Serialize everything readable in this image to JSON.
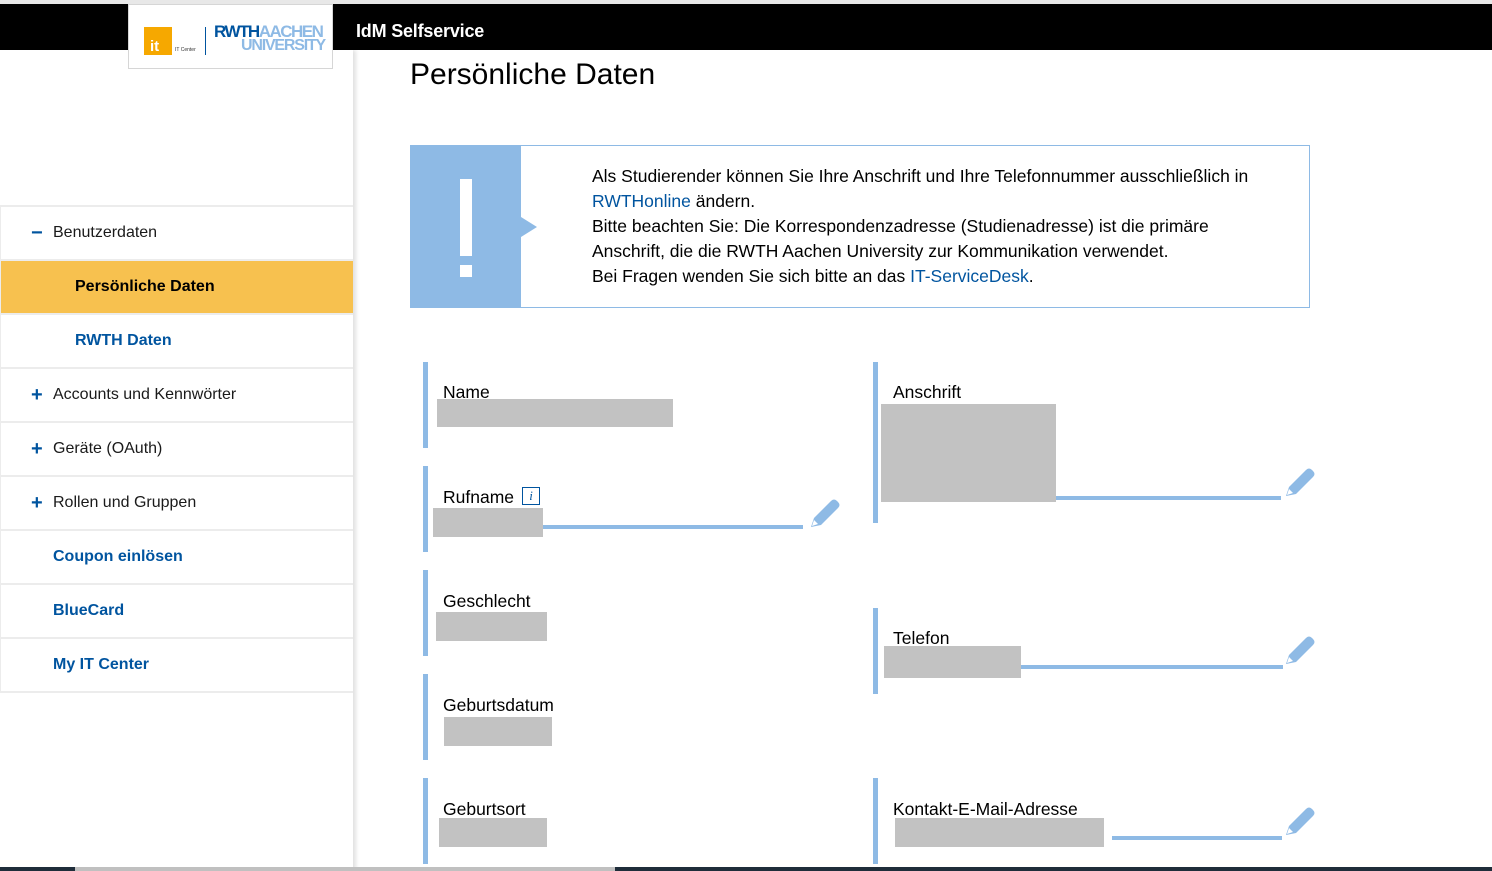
{
  "header": {
    "app_title": "IdM Selfservice",
    "logo": {
      "it_mark": "it",
      "it_center": "IT Center",
      "rwth": "RWTH",
      "aachen": "AACHEN",
      "university": "UNIVERSITY"
    }
  },
  "sidebar": {
    "items": [
      {
        "label": "Benutzerdaten",
        "symbol": "−",
        "state": "expanded"
      },
      {
        "label": "Persönliche Daten",
        "state": "active"
      },
      {
        "label": "RWTH Daten"
      },
      {
        "label": "Accounts und Kennwörter",
        "symbol": "+"
      },
      {
        "label": "Geräte (OAuth)",
        "symbol": "+"
      },
      {
        "label": "Rollen und Gruppen",
        "symbol": "+"
      },
      {
        "label": "Coupon einlösen"
      },
      {
        "label": "BlueCard"
      },
      {
        "label": "My IT Center"
      }
    ]
  },
  "main": {
    "title": "Persönliche Daten",
    "alert": {
      "line1": "Als Studierender können Sie Ihre Anschrift und Ihre Telefonnummer ausschließlich in",
      "link1": "RWTHonline",
      "line2_rest": " ändern.",
      "line3": "Bitte beachten Sie: Die Korrespondenzadresse (Studienadresse) ist die primäre",
      "line4": "Anschrift, die die RWTH Aachen University zur Kommunikation verwendet.",
      "line5_pre": "Bei Fragen wenden Sie sich bitte an das ",
      "link2": "IT-ServiceDesk",
      "line5_post": "."
    },
    "fields_left": [
      {
        "label": "Name",
        "value": "[redacted]",
        "editable": false
      },
      {
        "label": "Rufname",
        "value": "[redacted]",
        "editable": true,
        "info_icon": "i"
      },
      {
        "label": "Geschlecht",
        "value": "[redacted]",
        "editable": false
      },
      {
        "label": "Geburtsdatum",
        "value": "[redacted]",
        "editable": false
      },
      {
        "label": "Geburtsort",
        "value": "[redacted]",
        "editable": false
      }
    ],
    "fields_right": [
      {
        "label": "Anschrift",
        "value": "[redacted]",
        "editable": true
      },
      {
        "label": "Telefon",
        "value": "[redacted]",
        "editable": true
      },
      {
        "label": "Kontakt-E-Mail-Adresse",
        "value": "[redacted]",
        "editable": true
      }
    ]
  },
  "colors": {
    "brand_blue": "#00549f",
    "light_blue": "#8ebae5",
    "active_yellow": "#f7c14f",
    "redaction_gray": "#c2c2c2"
  }
}
